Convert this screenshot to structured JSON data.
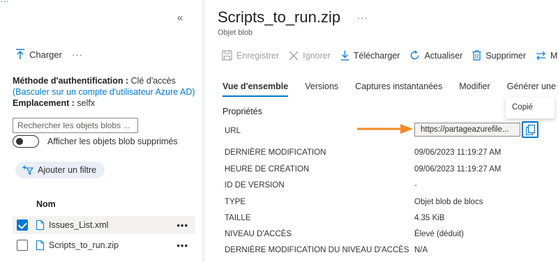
{
  "top_link": "…",
  "left_pane": {
    "collapse_icon": "double-chevron-left-icon",
    "upload_label": "Charger",
    "more_label": "···",
    "auth": {
      "method_label": "Méthode d'authentification :",
      "method_value": "Clé d'accès",
      "switch_link": "(Basculer sur un compte d'utilisateur Azure AD)",
      "location_label": "Emplacement :",
      "location_value": "selfx"
    },
    "search_placeholder": "Rechercher les objets blobs ...",
    "toggle_label": "Afficher les objets blob supprimés",
    "toggle_on": false,
    "add_filter": "Ajouter un filtre",
    "column_name": "Nom",
    "rows": [
      {
        "name": "Issues_List.xml",
        "checked": true
      },
      {
        "name": "Scripts_to_run.zip",
        "checked": false
      }
    ],
    "row_more": "•••"
  },
  "blob": {
    "title": "Scripts_to_run.zip",
    "title_more": "···",
    "subtitle": "Objet blob"
  },
  "toolbar": [
    {
      "label": "Enregistrer",
      "icon": "save-icon",
      "disabled": true
    },
    {
      "label": "Ignorer",
      "icon": "close-icon",
      "disabled": true
    },
    {
      "label": "Télécharger",
      "icon": "download-icon",
      "disabled": false
    },
    {
      "label": "Actualiser",
      "icon": "refresh-icon",
      "disabled": false
    },
    {
      "label": "Supprimer",
      "icon": "delete-icon",
      "disabled": false
    },
    {
      "label": "M",
      "icon": "change-tier-icon",
      "disabled": false
    }
  ],
  "tabs": [
    {
      "label": "Vue d'ensemble",
      "active": true
    },
    {
      "label": "Versions",
      "active": false
    },
    {
      "label": "Captures instantanées",
      "active": false
    },
    {
      "label": "Modifier",
      "active": false
    },
    {
      "label": "Générer une",
      "active": false
    }
  ],
  "section_title": "Propriétés",
  "properties": [
    {
      "key": "URL",
      "value": "https://partageazurefile..."
    },
    {
      "key": "DERNIÈRE MODIFICATION",
      "value": "09/06/2023 11:19:27 AM"
    },
    {
      "key": "HEURE DE CRÉATION",
      "value": "09/06/2023 11:19:27 AM"
    },
    {
      "key": "ID DE VERSION",
      "value": "-"
    },
    {
      "key": "TYPE",
      "value": "Objet blob de blocs"
    },
    {
      "key": "TAILLE",
      "value": "4.35 KiB"
    },
    {
      "key": "NIVEAU D'ACCÈS",
      "value": "Élevé (déduit)"
    },
    {
      "key": "DERNIÈRE MODIFICATION DU NIVEAU D'ACCÈS",
      "value": "N/A"
    }
  ],
  "tooltip": "Copié",
  "colors": {
    "accent": "#0078d4",
    "arrow": "#f08a24",
    "pill": "#e9eef7"
  }
}
